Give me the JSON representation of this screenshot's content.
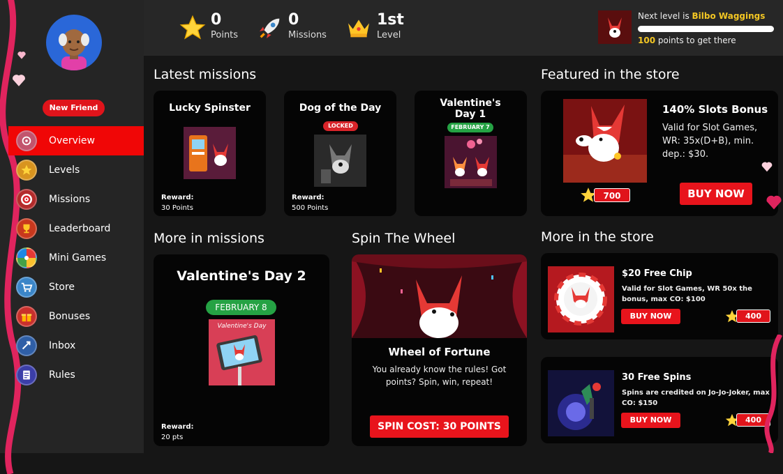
{
  "sidebar": {
    "new_friend": "New Friend",
    "items": [
      {
        "label": "Overview",
        "icon": "overview-icon",
        "active": true
      },
      {
        "label": "Levels",
        "icon": "star-icon"
      },
      {
        "label": "Missions",
        "icon": "target-icon"
      },
      {
        "label": "Leaderboard",
        "icon": "trophy-icon"
      },
      {
        "label": "Mini Games",
        "icon": "wheel-icon"
      },
      {
        "label": "Store",
        "icon": "cart-icon"
      },
      {
        "label": "Bonuses",
        "icon": "gift-icon"
      },
      {
        "label": "Inbox",
        "icon": "inbox-icon"
      },
      {
        "label": "Rules",
        "icon": "rules-icon"
      }
    ]
  },
  "stats": {
    "points": {
      "value": "0",
      "label": "Points"
    },
    "missions": {
      "value": "0",
      "label": "Missions"
    },
    "level": {
      "value": "1st",
      "label": "Level"
    }
  },
  "next_level": {
    "prefix": "Next level is ",
    "name": "Bilbo Waggings",
    "points": "100",
    "suffix": " points to get there",
    "progress": 0
  },
  "latest_missions": {
    "title": "Latest missions",
    "cards": [
      {
        "title": "Lucky Spinster",
        "badge": "",
        "reward_label": "Reward:",
        "reward": "30 Points"
      },
      {
        "title": "Dog of the Day",
        "badge": "LOCKED",
        "reward_label": "Reward:",
        "reward": "500 Points"
      },
      {
        "title": "Valentine's Day 1",
        "badge": "FEBRUARY 7",
        "reward_label": "",
        "reward": ""
      }
    ]
  },
  "featured": {
    "title": "Featured in the store",
    "product": "140% Slots Bonus",
    "desc": "Valid for Slot Games, WR: 35x(D+B), min. dep.: $30.",
    "price": "700",
    "buy": "BUY NOW"
  },
  "more_missions": {
    "title": "More in missions",
    "card": {
      "title": "Valentine's Day 2",
      "badge": "FEBRUARY 8",
      "image_text": "Valentine's Day",
      "reward_label": "Reward:",
      "reward": "20 pts"
    }
  },
  "spin": {
    "title": "Spin The Wheel",
    "heading": "Wheel of Fortune",
    "text": "You already know the rules! Got points? Spin, win, repeat!",
    "button": "SPIN COST: 30 POINTS"
  },
  "more_store": {
    "title": "More in the store",
    "items": [
      {
        "name": "$20 Free Chip",
        "desc": "Valid for Slot Games, WR 50x the bonus, max CO: $100",
        "buy": "BUY NOW",
        "price": "400"
      },
      {
        "name": "30 Free Spins",
        "desc": "Spins are credited on Jo-Jo-Joker, max CO: $150",
        "buy": "BUY NOW",
        "price": "400"
      }
    ]
  },
  "colors": {
    "accent": "#e8141c",
    "gold": "#f3c623",
    "green": "#25a244",
    "bg": "#161616"
  }
}
